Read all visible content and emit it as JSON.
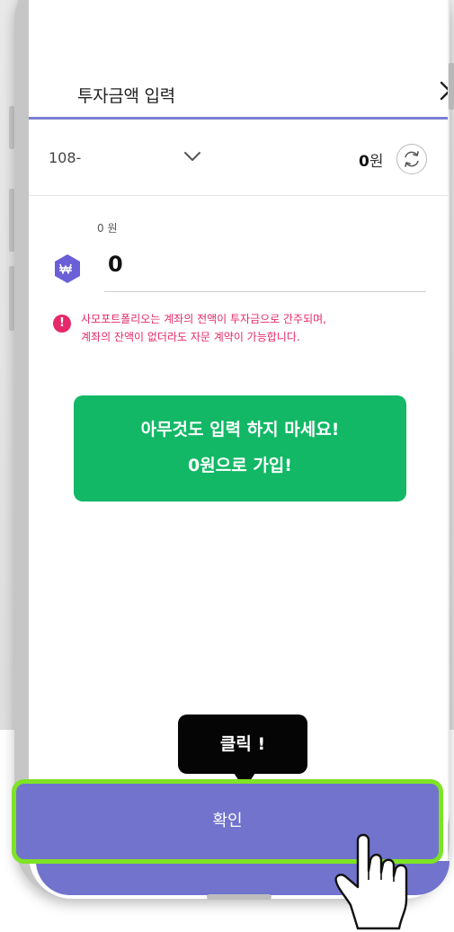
{
  "header": {
    "title": "투자금액 입력"
  },
  "account": {
    "number": "108-",
    "balance_value": "0",
    "balance_unit": "원"
  },
  "input": {
    "label": "0 원",
    "amount": "0"
  },
  "warning": {
    "line1": "사모포트폴리오는 계좌의 전액이 투자금으로 간주되며,",
    "line2": "계좌의 잔액이 없더라도 자문 계약이 가능합니다."
  },
  "callout": {
    "line1": "아무것도 입력 하지 마세요!",
    "line2": "0원으로 가입!"
  },
  "tooltip": {
    "label": "클릭 !"
  },
  "footer": {
    "confirm_label": "확인"
  },
  "colors": {
    "accent": "#7173cd",
    "header_line": "#7b7fd0",
    "warning": "#e5296b",
    "callout": "#12b866",
    "highlight": "#7ee324"
  },
  "icons": {
    "close": "close-icon",
    "dropdown": "chevron-down-icon",
    "refresh": "refresh-icon",
    "currency": "won-icon",
    "warning": "exclamation-icon",
    "pointer": "pointing-hand-icon"
  }
}
